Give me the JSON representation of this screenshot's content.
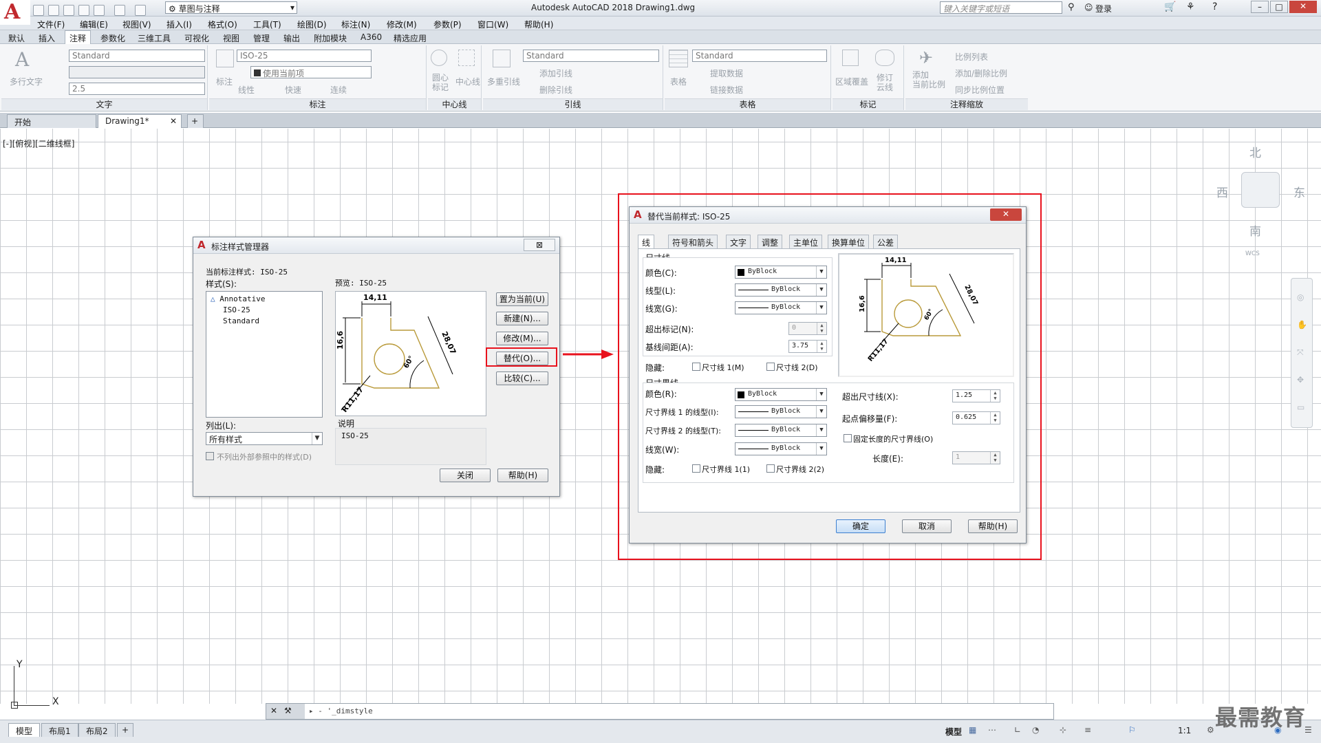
{
  "app": {
    "title": "Autodesk AutoCAD 2018    Drawing1.dwg",
    "workspace": "草图与注释",
    "search_placeholder": "键入关键字或短语",
    "login": "登录"
  },
  "menu": [
    "文件(F)",
    "编辑(E)",
    "视图(V)",
    "插入(I)",
    "格式(O)",
    "工具(T)",
    "绘图(D)",
    "标注(N)",
    "修改(M)",
    "参数(P)",
    "窗口(W)",
    "帮助(H)"
  ],
  "ribbon_tabs": [
    "默认",
    "插入",
    "注释",
    "参数化",
    "三维工具",
    "可视化",
    "视图",
    "管理",
    "输出",
    "附加模块",
    "A360",
    "精选应用"
  ],
  "ribbon": {
    "text": {
      "label": "文字",
      "mtext": "多行文字",
      "style": "Standard",
      "height": "2.5"
    },
    "dim": {
      "label": "标注",
      "style": "ISO-25",
      "use_current": "使用当前项",
      "big": "标注",
      "linear": "线性",
      "quick": "快速",
      "continue": "连续"
    },
    "center": {
      "label": "中心线",
      "mark": "圆心\n标记",
      "line": "中心线"
    },
    "leader": {
      "label": "引线",
      "multi": "多重引线",
      "style": "Standard",
      "add": "添加引线",
      "remove": "删除引线"
    },
    "table": {
      "label": "表格",
      "big": "表格",
      "style": "Standard",
      "extract": "提取数据",
      "link": "链接数据"
    },
    "mark": {
      "label": "标记",
      "wipe": "区域覆盖",
      "cloud": "修订\n云线"
    },
    "scale": {
      "label": "注释缩放",
      "add": "添加\n当前比例",
      "list": "比例列表",
      "add_del": "添加/删除比例",
      "sync": "同步比例位置"
    }
  },
  "doc_tabs": [
    "开始",
    "Drawing1*"
  ],
  "viewport_label": "[-][俯视][二维线框]",
  "viewcube": {
    "n": "北",
    "s": "南",
    "e": "东",
    "w": "西",
    "wcs": "WCS"
  },
  "ucs": {
    "y": "Y",
    "x": "X"
  },
  "command": {
    "text": "'_dimstyle"
  },
  "layout_tabs": [
    "模型",
    "布局1",
    "布局2"
  ],
  "status": {
    "model": "模型",
    "scale": "1:1"
  },
  "watermark": "最需教育",
  "dsm": {
    "title": "标注样式管理器",
    "current": "当前标注样式: ISO-25",
    "styles_label": "样式(S):",
    "styles": [
      "Annotative",
      "ISO-25",
      "Standard"
    ],
    "preview": "预览: ISO-25",
    "list_label": "列出(L):",
    "list_value": "所有样式",
    "no_xref": "不列出外部参照中的样式(D)",
    "desc_label": "说明",
    "desc": "ISO-25",
    "buttons": {
      "set_current": "置为当前(U)",
      "new": "新建(N)...",
      "modify": "修改(M)...",
      "override": "替代(O)...",
      "compare": "比较(C)...",
      "close": "关闭",
      "help": "帮助(H)"
    }
  },
  "ov": {
    "title": "替代当前样式: ISO-25",
    "tabs": [
      "线",
      "符号和箭头",
      "文字",
      "调整",
      "主单位",
      "换算单位",
      "公差"
    ],
    "dimline": {
      "group": "尺寸线",
      "color_l": "颜色(C):",
      "color": "ByBlock",
      "ltype_l": "线型(L):",
      "ltype": "ByBlock",
      "lw_l": "线宽(G):",
      "lw": "ByBlock",
      "ext_l": "超出标记(N):",
      "ext": "0",
      "base_l": "基线间距(A):",
      "base": "3.75",
      "sup_l": "隐藏:",
      "s1": "尺寸线 1(M)",
      "s2": "尺寸线 2(D)"
    },
    "extline": {
      "group": "尺寸界线",
      "color_l": "颜色(R):",
      "color": "ByBlock",
      "l1_l": "尺寸界线 1 的线型(I):",
      "l1": "ByBlock",
      "l2_l": "尺寸界线 2 的线型(T):",
      "l2": "ByBlock",
      "lw_l": "线宽(W):",
      "lw": "ByBlock",
      "sup_l": "隐藏:",
      "s1": "尺寸界线 1(1)",
      "s2": "尺寸界线 2(2)",
      "beyond_l": "超出尺寸线(X):",
      "beyond": "1.25",
      "offset_l": "起点偏移量(F):",
      "offset": "0.625",
      "fixed": "固定长度的尺寸界线(O)",
      "len_l": "长度(E):",
      "len": "1"
    },
    "buttons": {
      "ok": "确定",
      "cancel": "取消",
      "help": "帮助(H)"
    }
  },
  "preview_dims": {
    "d1": "14,11",
    "d2": "16,6",
    "d3": "28,07",
    "d4": "60°",
    "d5": "R11,17"
  },
  "colors": {
    "highlight": "#e8111c",
    "accent": "#c0282d",
    "geometry": "#b99a3a"
  }
}
